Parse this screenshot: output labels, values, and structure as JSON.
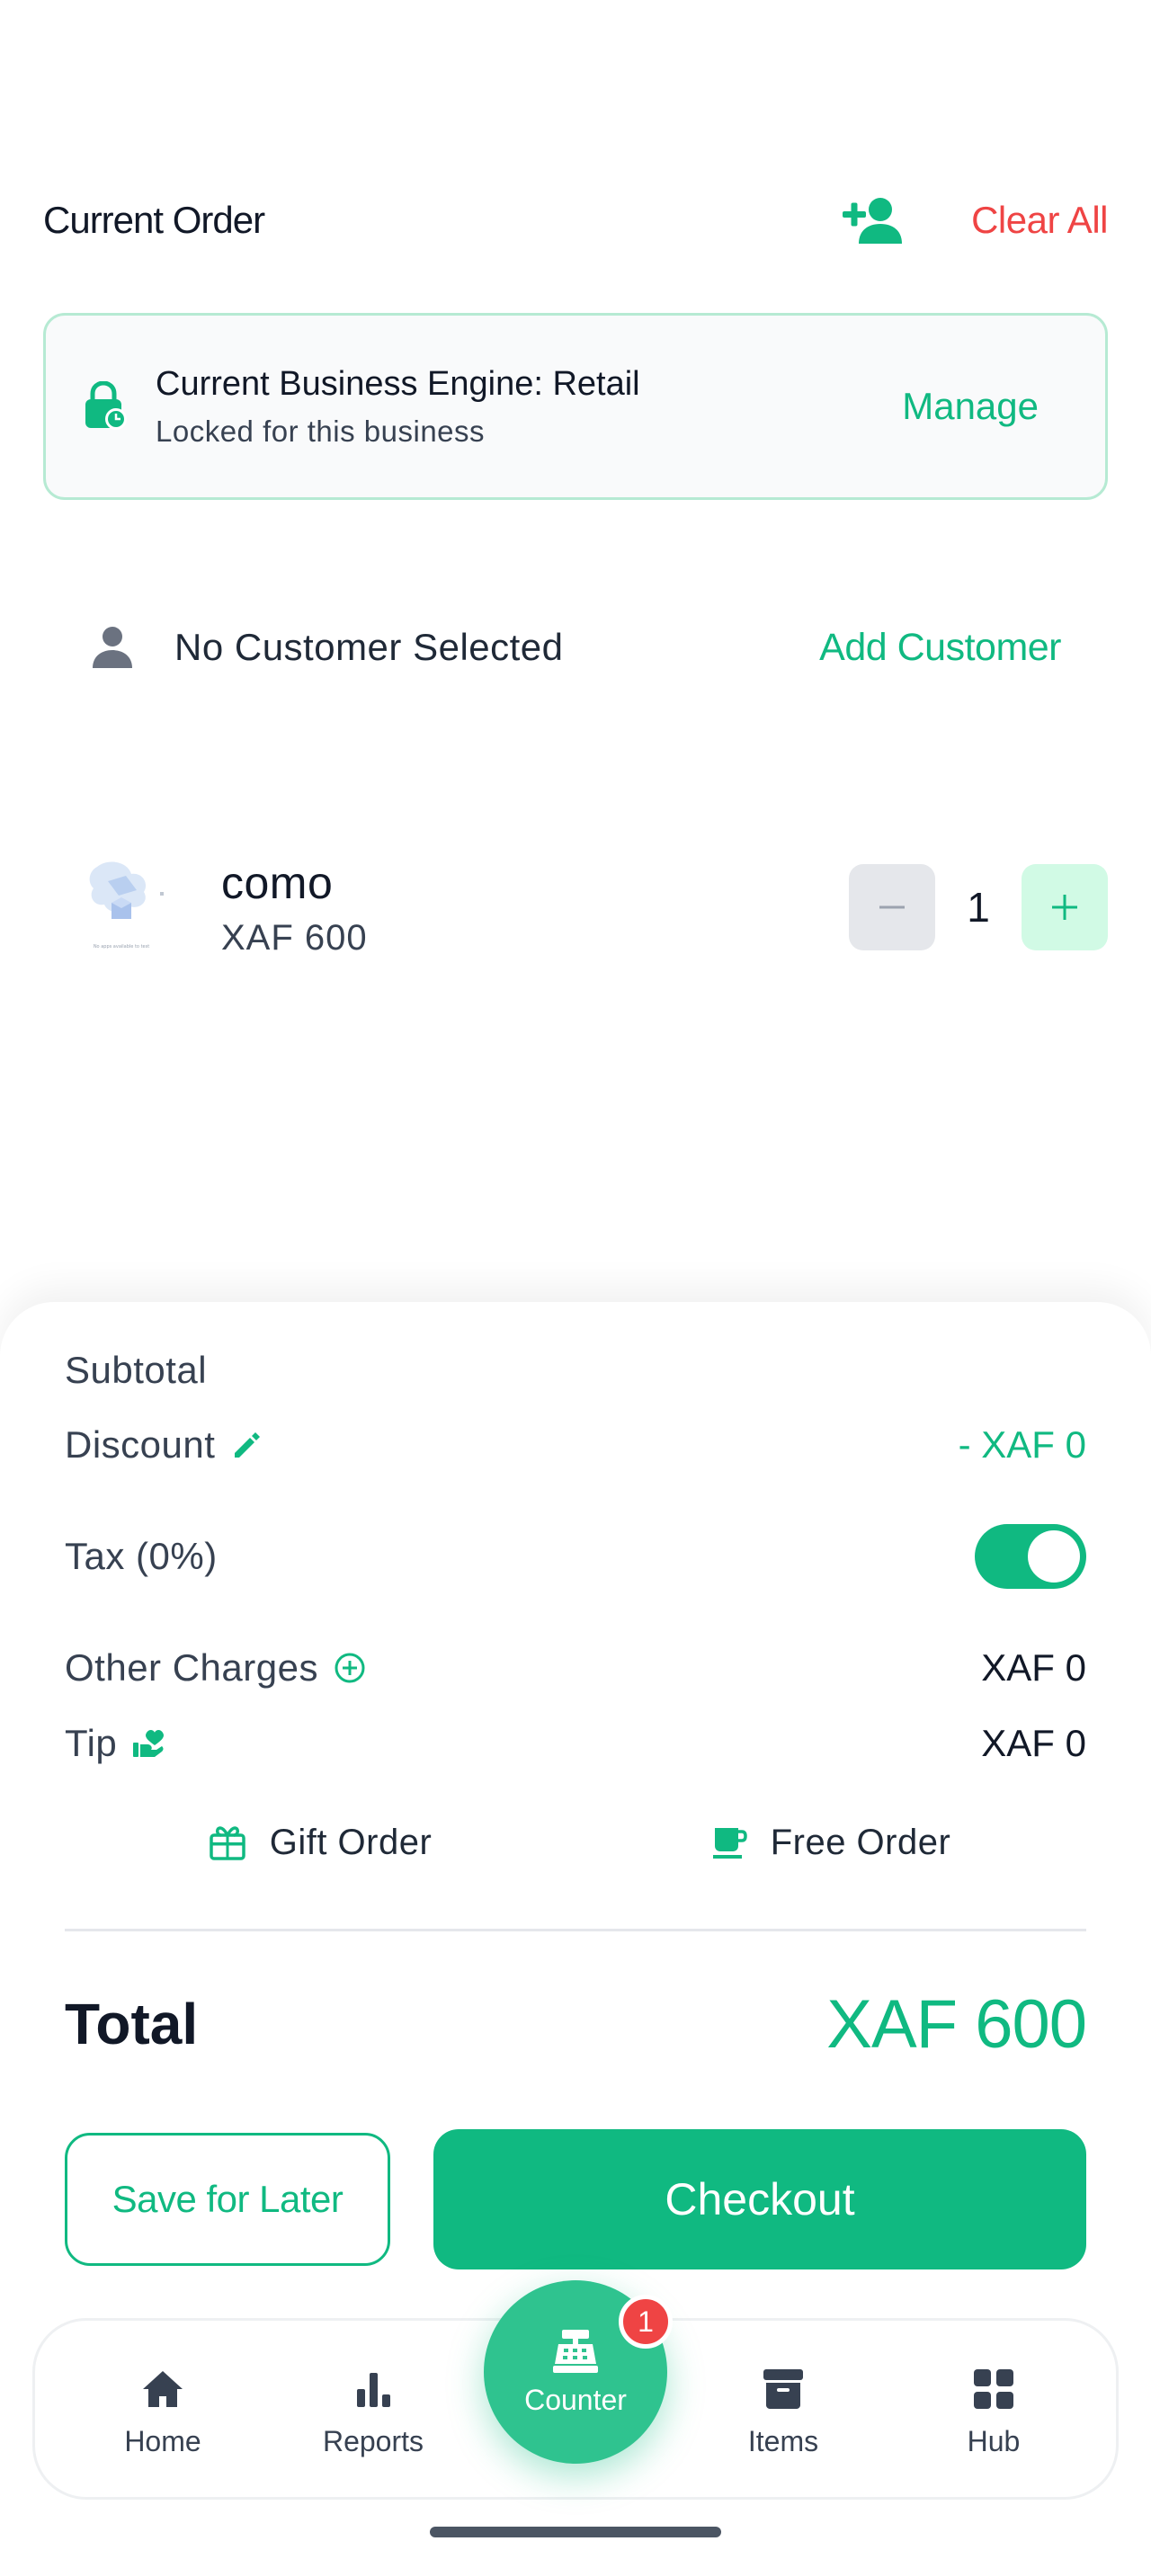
{
  "header": {
    "title": "Current Order",
    "clear_all_label": "Clear All"
  },
  "engine": {
    "title": "Current Business Engine: Retail",
    "subtitle": "Locked for this business",
    "manage_label": "Manage"
  },
  "customer": {
    "label": "No Customer Selected",
    "add_label": "Add Customer"
  },
  "items": [
    {
      "name": "como",
      "price": "XAF 600",
      "quantity": "1",
      "thumb_caption": "No apps available to test"
    }
  ],
  "summary": {
    "subtotal_label": "Subtotal",
    "discount_label": "Discount",
    "discount_value": "- XAF 0",
    "tax_label": "Tax (0%)",
    "tax_enabled": true,
    "other_charges_label": "Other Charges",
    "other_charges_value": "XAF 0",
    "tip_label": "Tip",
    "tip_value": "XAF 0",
    "gift_order_label": "Gift Order",
    "free_order_label": "Free Order",
    "total_label": "Total",
    "total_value": "XAF 600"
  },
  "actions": {
    "save_label": "Save for Later",
    "checkout_label": "Checkout"
  },
  "nav": {
    "home": "Home",
    "reports": "Reports",
    "counter": "Counter",
    "counter_badge": "1",
    "items": "Items",
    "hub": "Hub"
  },
  "colors": {
    "accent": "#10b981",
    "danger": "#ef4444",
    "text": "#1f2937",
    "muted": "#374151"
  }
}
